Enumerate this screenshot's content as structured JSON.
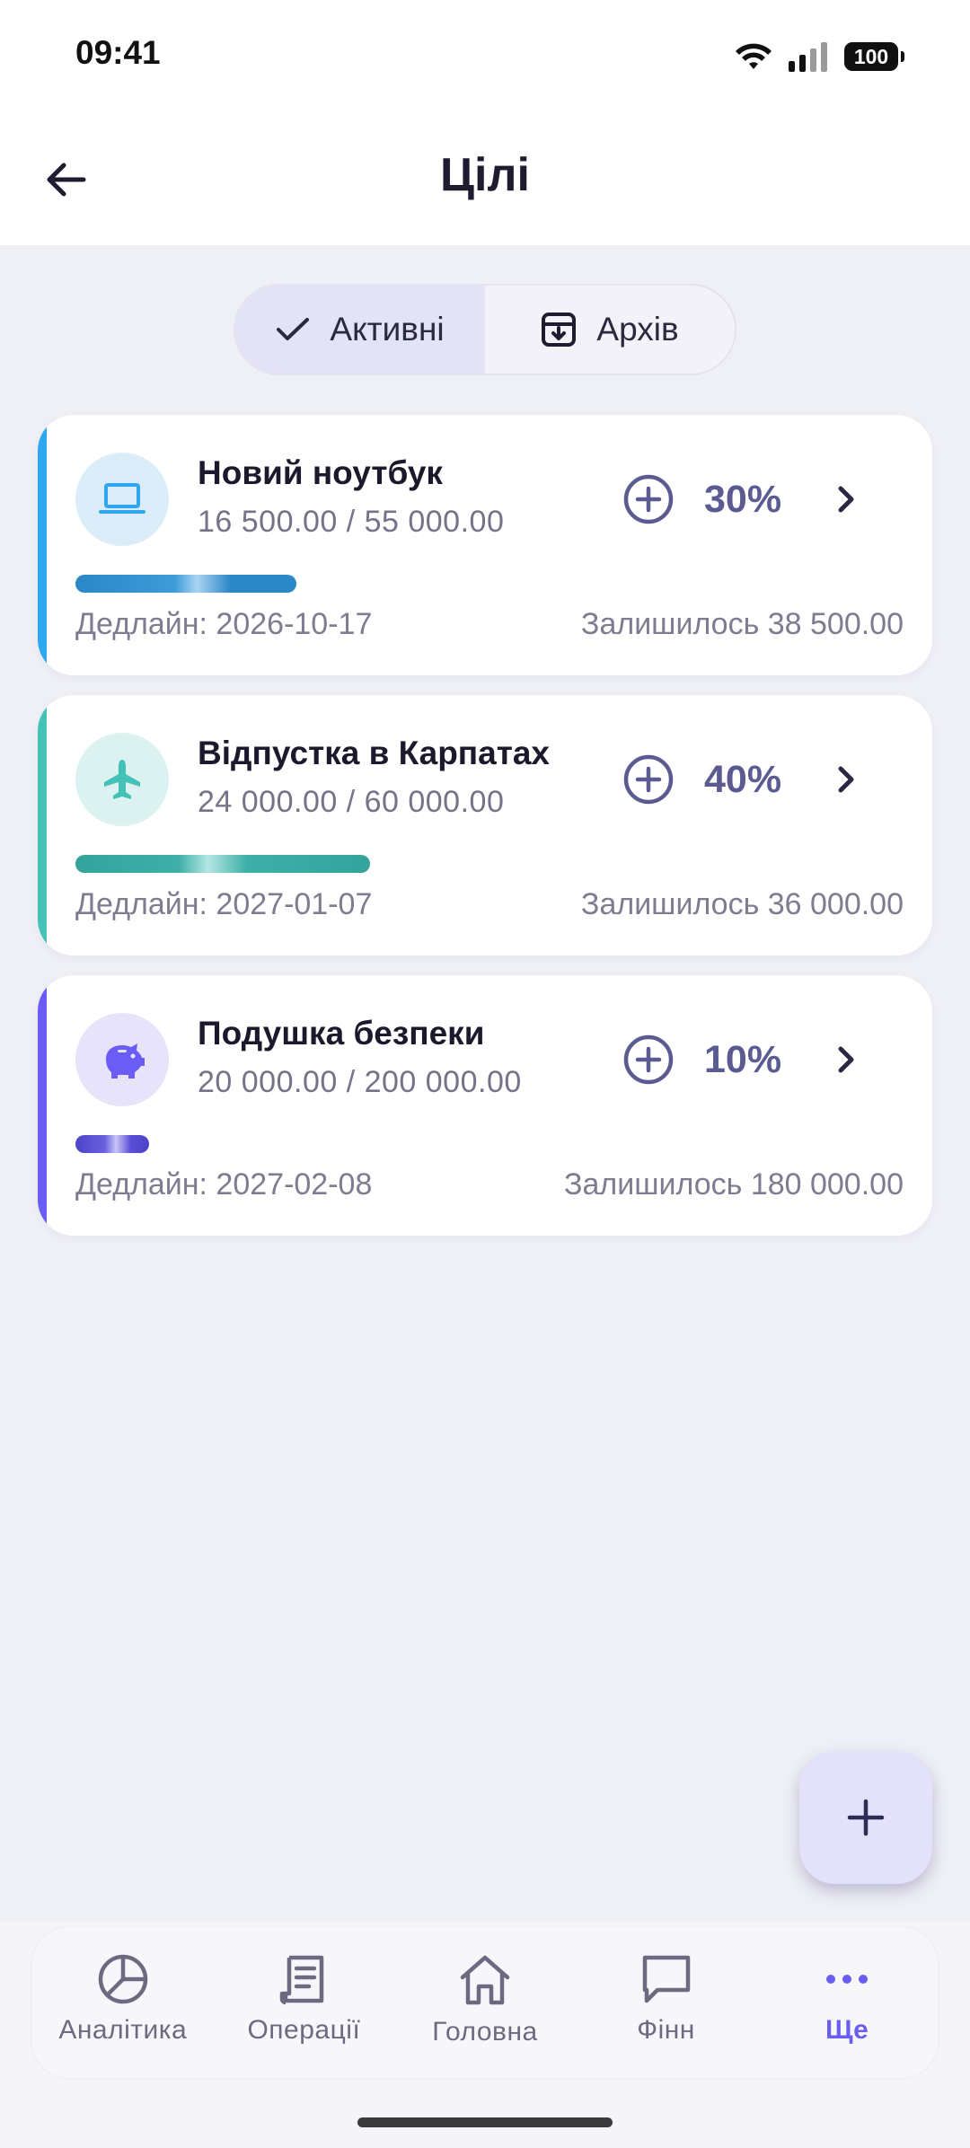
{
  "status_bar": {
    "time": "09:41",
    "battery": "100"
  },
  "header": {
    "title": "Цілі"
  },
  "segmented": {
    "active_label": "Активні",
    "archive_label": "Архів"
  },
  "goals": [
    {
      "name": "Новий ноутбук",
      "amount": "16 500.00 / 55 000.00",
      "percent_label": "30%",
      "progress": 0.3,
      "deadline": "Дедлайн: 2026-10-17",
      "remaining": "Залишилось 38 500.00",
      "icon": "laptop-icon",
      "accent": "#2ea7f0",
      "icon_bg": "#dcedfa",
      "bar_color": "#2b88c8"
    },
    {
      "name": "Відпустка в Карпатах",
      "amount": "24 000.00 / 60 000.00",
      "percent_label": "40%",
      "progress": 0.4,
      "deadline": "Дедлайн: 2027-01-07",
      "remaining": "Залишилось 36 000.00",
      "icon": "airplane-icon",
      "accent": "#45c2b8",
      "icon_bg": "#dcf2f0",
      "bar_color": "#33a39c"
    },
    {
      "name": "Подушка безпеки",
      "amount": "20 000.00 / 200 000.00",
      "percent_label": "10%",
      "progress": 0.1,
      "deadline": "Дедлайн: 2027-02-08",
      "remaining": "Залишилось 180 000.00",
      "icon": "piggy-bank-icon",
      "accent": "#6b5cf5",
      "icon_bg": "#e6e3fb",
      "bar_color": "#5a4fd6"
    }
  ],
  "nav": {
    "analytics": "Аналітика",
    "operations": "Операції",
    "home": "Головна",
    "finn": "Фінн",
    "more": "Ще"
  },
  "colors": {
    "accent": "#6a5ef0",
    "percent": "#5b5b92"
  }
}
